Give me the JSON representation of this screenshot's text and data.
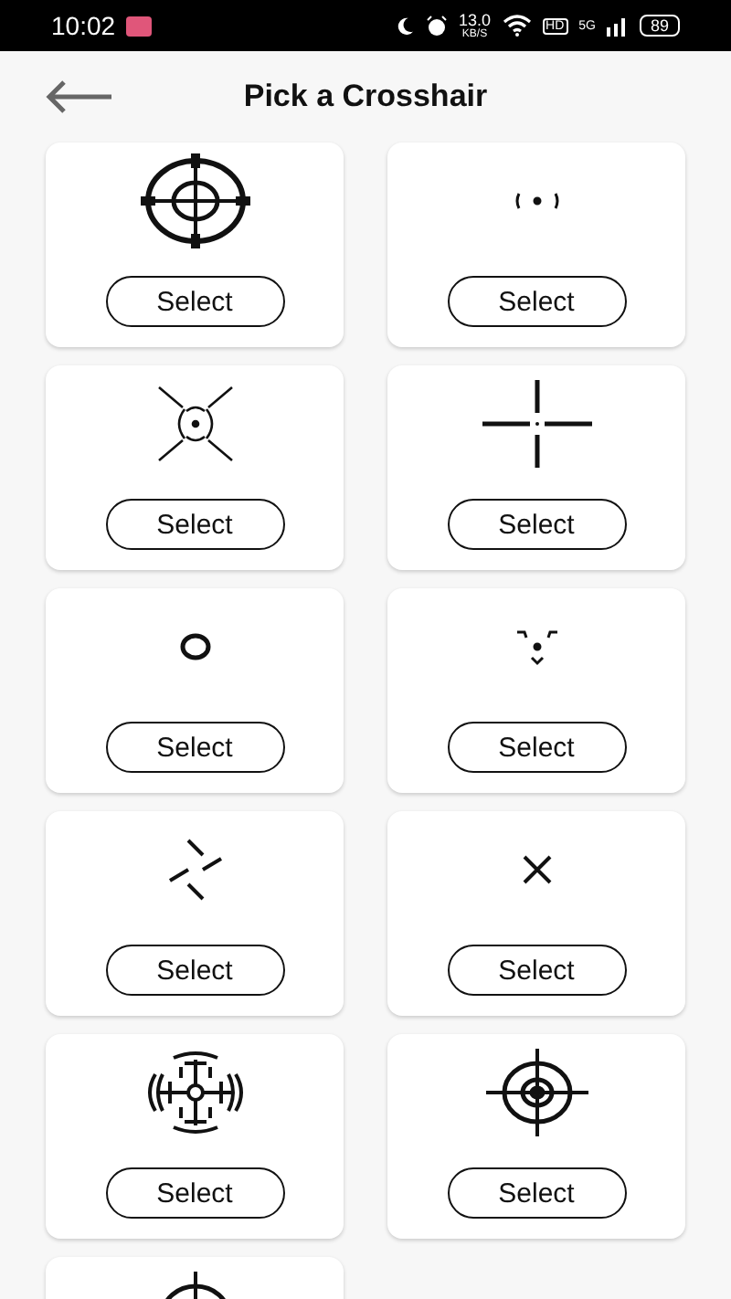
{
  "status_bar": {
    "time": "10:02",
    "speed": "13.0",
    "speed_unit": "KB/S",
    "hd": "HD",
    "network": "5G",
    "battery": "89"
  },
  "header": {
    "back": true,
    "title": "Pick a Crosshair"
  },
  "crosshairs": [
    {
      "kind": "scope",
      "button": "Select"
    },
    {
      "kind": "bracket-dot",
      "button": "Select"
    },
    {
      "kind": "bracket-x",
      "button": "Select"
    },
    {
      "kind": "gap-cross",
      "button": "Select"
    },
    {
      "kind": "ring",
      "button": "Select"
    },
    {
      "kind": "chevron-dot",
      "button": "Select"
    },
    {
      "kind": "pinwheel",
      "button": "Select"
    },
    {
      "kind": "x-mark",
      "button": "Select"
    },
    {
      "kind": "radar",
      "button": "Select"
    },
    {
      "kind": "target",
      "button": "Select"
    },
    {
      "kind": "target"
    }
  ]
}
